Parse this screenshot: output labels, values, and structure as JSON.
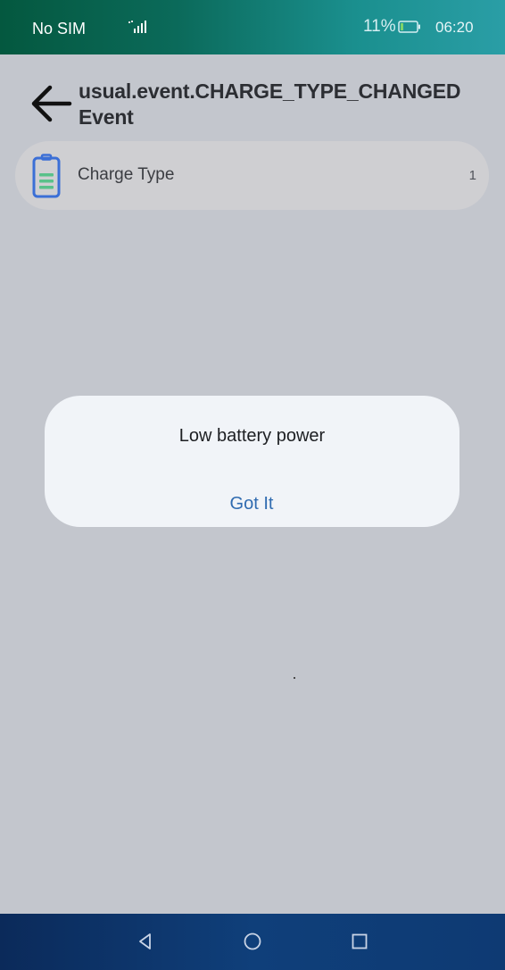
{
  "status_bar": {
    "sim_status": "No SIM",
    "signal_icon": "signal-bars-icon",
    "battery_percent": "11%",
    "battery_icon": "battery-low-icon",
    "time": "06:20"
  },
  "header": {
    "back_icon": "arrow-left-icon",
    "title": "usual.event.CHARGE_TYPE_CHANGED Event"
  },
  "card": {
    "icon": "battery-clipboard-icon",
    "label": "Charge Type",
    "value": "1"
  },
  "dialog": {
    "message": "Low battery power",
    "button_label": "Got It"
  },
  "nav_bar": {
    "back_icon": "triangle-back-icon",
    "home_icon": "circle-home-icon",
    "recents_icon": "square-recents-icon"
  },
  "colors": {
    "accent": "#2f6bb0",
    "background_scrim": "#c3c6cd",
    "dialog_bg": "#f1f4f8",
    "icon_blue": "#3b6fd6",
    "icon_green": "#59c18a"
  }
}
